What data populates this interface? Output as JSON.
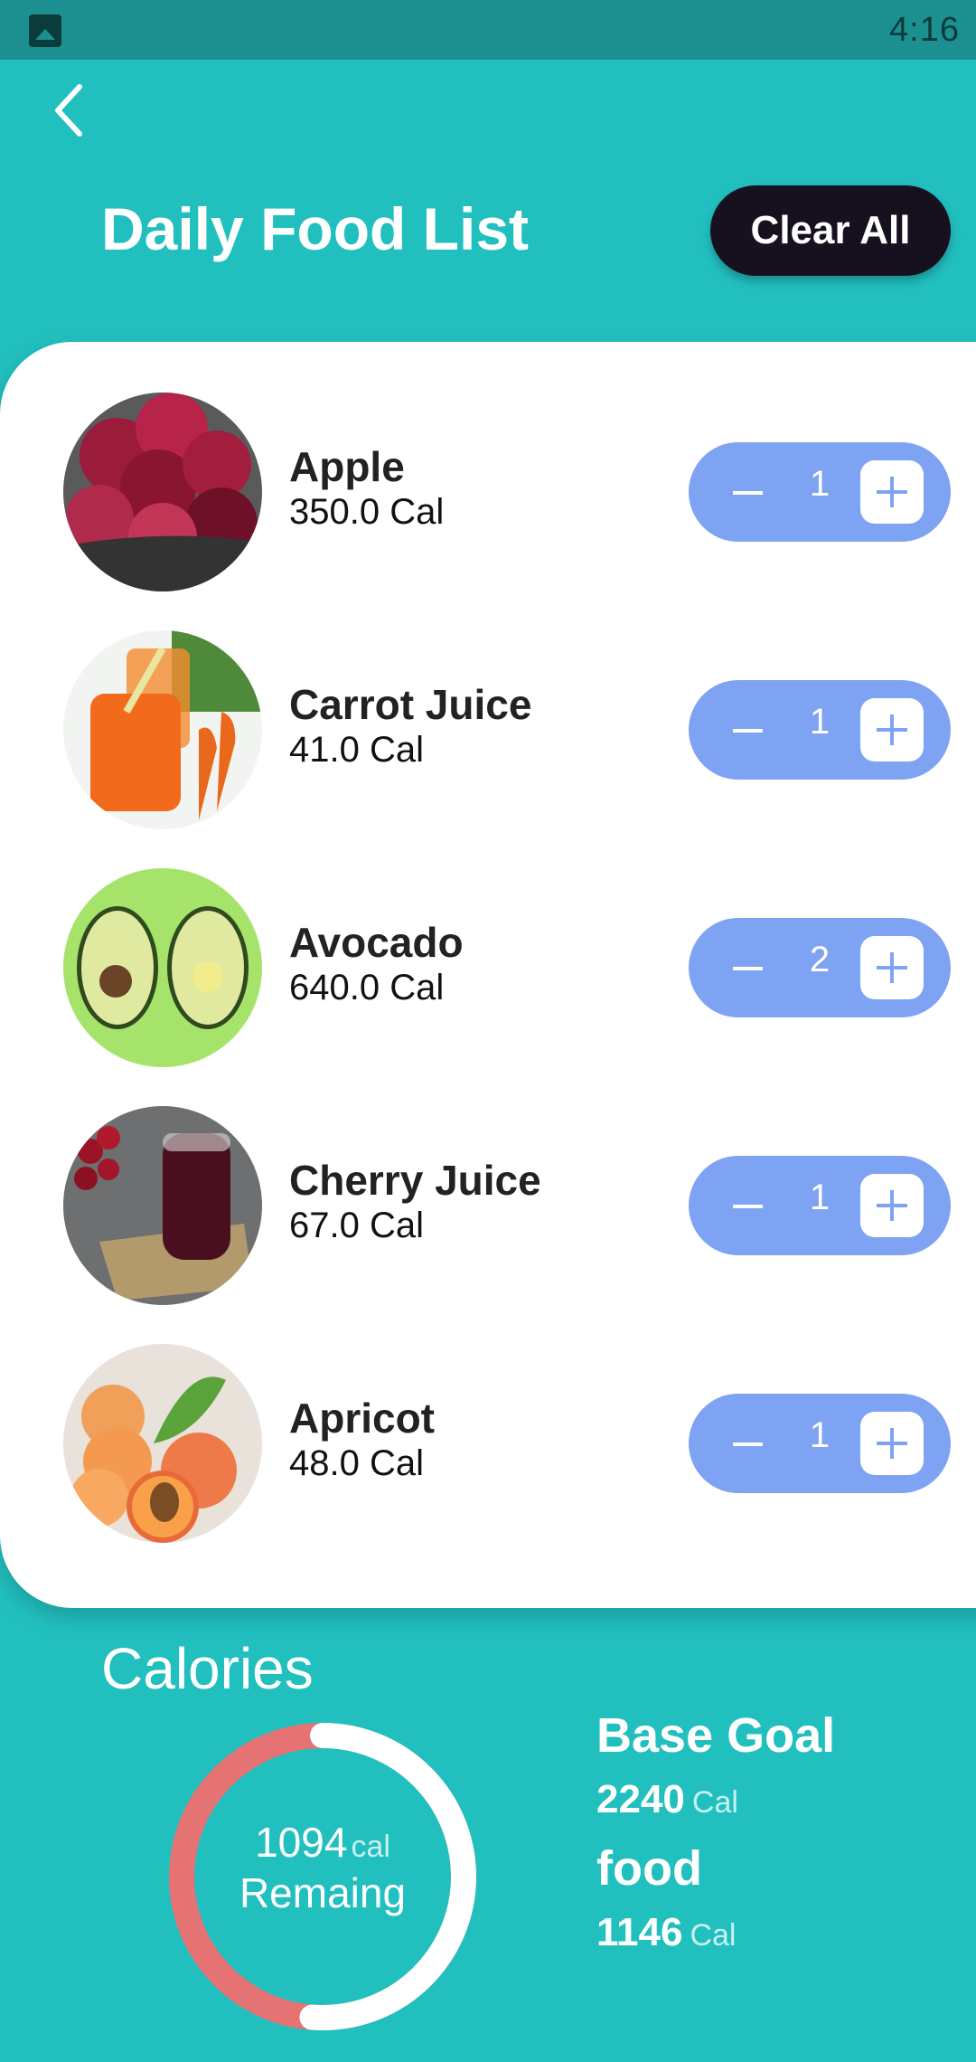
{
  "status_bar": {
    "time": "4:16",
    "notification_icon": "image-icon"
  },
  "header": {
    "back_icon": "chevron-left-icon",
    "title": "Daily Food List",
    "clear_all_label": "Clear All"
  },
  "food_list": [
    {
      "name": "Apple",
      "calories": "350.0 Cal",
      "quantity": "1",
      "image": "apples-in-bowl"
    },
    {
      "name": "Carrot Juice",
      "calories": "41.0 Cal",
      "quantity": "1",
      "image": "carrot-juice-glass"
    },
    {
      "name": "Avocado",
      "calories": "640.0 Cal",
      "quantity": "2",
      "image": "avocado-halves"
    },
    {
      "name": "Cherry Juice",
      "calories": "67.0 Cal",
      "quantity": "1",
      "image": "cherry-juice-glass"
    },
    {
      "name": "Apricot",
      "calories": "48.0 Cal",
      "quantity": "1",
      "image": "apricots"
    }
  ],
  "calories": {
    "title": "Calories",
    "remaining_value": "1094",
    "remaining_unit": "cal",
    "remaining_label": "Remaing",
    "consumed_fraction": 0.5116,
    "base_goal_label": "Base Goal",
    "base_goal_value": "2240",
    "base_goal_unit": "Cal",
    "food_label": "food",
    "food_value": "1146",
    "food_unit": "Cal"
  },
  "colors": {
    "background": "#22bfbf",
    "status_bar": "#1c9090",
    "stepper": "#7fa3f3",
    "clear_button": "#17111f",
    "ring_remaining": "#e57373",
    "ring_consumed": "#ffffff"
  }
}
